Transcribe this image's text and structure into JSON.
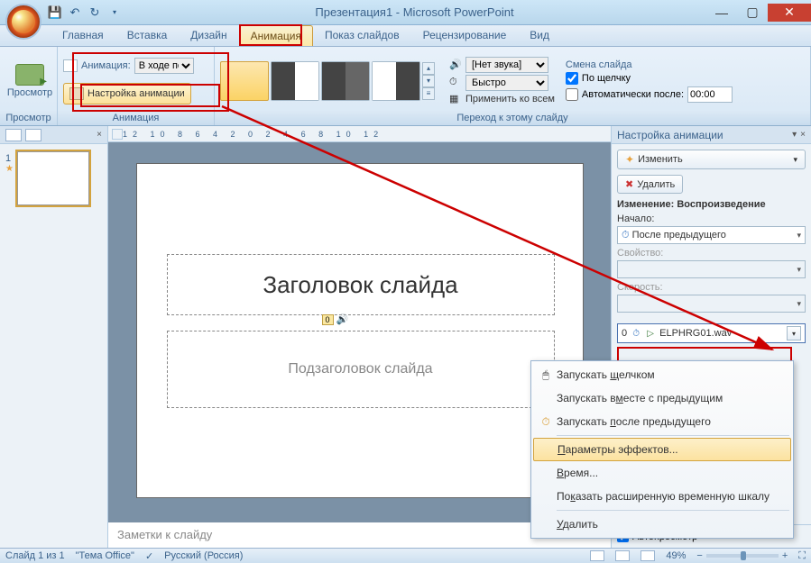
{
  "title": "Презентация1 - Microsoft PowerPoint",
  "tabs": {
    "home": "Главная",
    "insert": "Вставка",
    "design": "Дизайн",
    "animation": "Анимация",
    "slideshow": "Показ слайдов",
    "review": "Рецензирование",
    "view": "Вид"
  },
  "ribbon": {
    "preview": {
      "label": "Просмотр",
      "group": "Просмотр"
    },
    "animation": {
      "label": "Анимация:",
      "combo_value": "В ходе посл...",
      "setup": "Настройка анимации",
      "group": "Анимация"
    },
    "transition": {
      "sound_label": "[Нет звука]",
      "speed_label": "Быстро",
      "apply_all": "Применить ко всем",
      "group": "Переход к этому слайду"
    },
    "change": {
      "header": "Смена слайда",
      "on_click": "По щелчку",
      "auto_after": "Автоматически после:",
      "time": "00:00"
    }
  },
  "slide": {
    "title_ph": "Заголовок слайда",
    "subtitle_ph": "Подзаголовок слайда",
    "tag_num": "0",
    "notes": "Заметки к слайду"
  },
  "taskpane": {
    "header": "Настройка анимации",
    "change_btn": "Изменить",
    "delete_btn": "Удалить",
    "change_play": "Изменение: Воспроизведение",
    "start_label": "Начало:",
    "start_value": "После предыдущего",
    "property_label": "Свойство:",
    "speed_label": "Скорость:",
    "item_num": "0",
    "item_name": "ELPHRG01.wav",
    "autopreview": "Автопросмотр"
  },
  "context": {
    "on_click": "Запускать щелчком",
    "with_prev": "Запускать вместе с предыдущим",
    "after_prev": "Запускать после предыдущего",
    "effect_opts": "Параметры эффектов...",
    "timing": "Время...",
    "show_timeline": "Показать расширенную временную шкалу",
    "delete": "Удалить"
  },
  "status": {
    "slide_count": "Слайд 1 из 1",
    "theme": "\"Тема Office\"",
    "lang": "Русский (Россия)",
    "zoom": "49%"
  }
}
